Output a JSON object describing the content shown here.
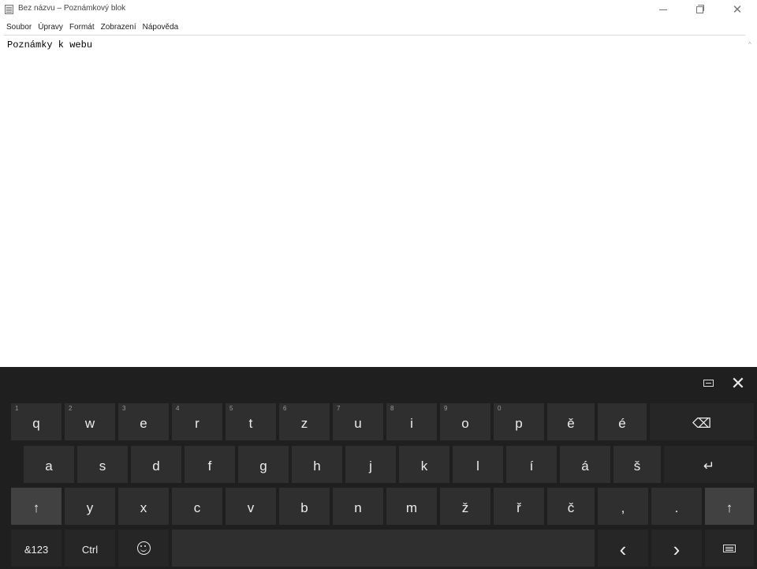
{
  "window": {
    "title": "Bez názvu – Poznámkový blok",
    "minimize_icon": "minimize-icon",
    "maximize_icon": "restore-icon",
    "close_icon": "close-icon",
    "close_glyph": "✕"
  },
  "menu": {
    "items": [
      "Soubor",
      "Úpravy",
      "Formát",
      "Zobrazení",
      "Nápověda"
    ]
  },
  "editor": {
    "content": "Poznámky k webu",
    "scroll_up_glyph": "^"
  },
  "keyboard": {
    "close_glyph": "✕",
    "row1": [
      {
        "label": "q",
        "num": "1"
      },
      {
        "label": "w",
        "num": "2"
      },
      {
        "label": "e",
        "num": "3"
      },
      {
        "label": "r",
        "num": "4"
      },
      {
        "label": "t",
        "num": "5"
      },
      {
        "label": "z",
        "num": "6"
      },
      {
        "label": "u",
        "num": "7"
      },
      {
        "label": "i",
        "num": "8"
      },
      {
        "label": "o",
        "num": "9"
      },
      {
        "label": "p",
        "num": "0"
      },
      {
        "label": "ě",
        "num": ""
      },
      {
        "label": "é",
        "num": ""
      },
      {
        "label": "⌫",
        "num": ""
      }
    ],
    "row2": [
      "a",
      "s",
      "d",
      "f",
      "g",
      "h",
      "j",
      "k",
      "l",
      "í",
      "á",
      "š",
      "↵"
    ],
    "row3": [
      "↑",
      "y",
      "x",
      "c",
      "v",
      "b",
      "n",
      "m",
      "ž",
      "ř",
      "č",
      ",",
      ".",
      "↑"
    ],
    "row4": {
      "symbols": "&123",
      "ctrl": "Ctrl",
      "emoji_icon": "emoji-icon",
      "space": "",
      "left": "‹",
      "right": "›",
      "keyboard_icon": "keyboard-icon"
    },
    "colors": {
      "background": "#1f1f1f",
      "key": "#2f2f2f",
      "modifier_key": "#414141",
      "text": "#ececec"
    }
  }
}
